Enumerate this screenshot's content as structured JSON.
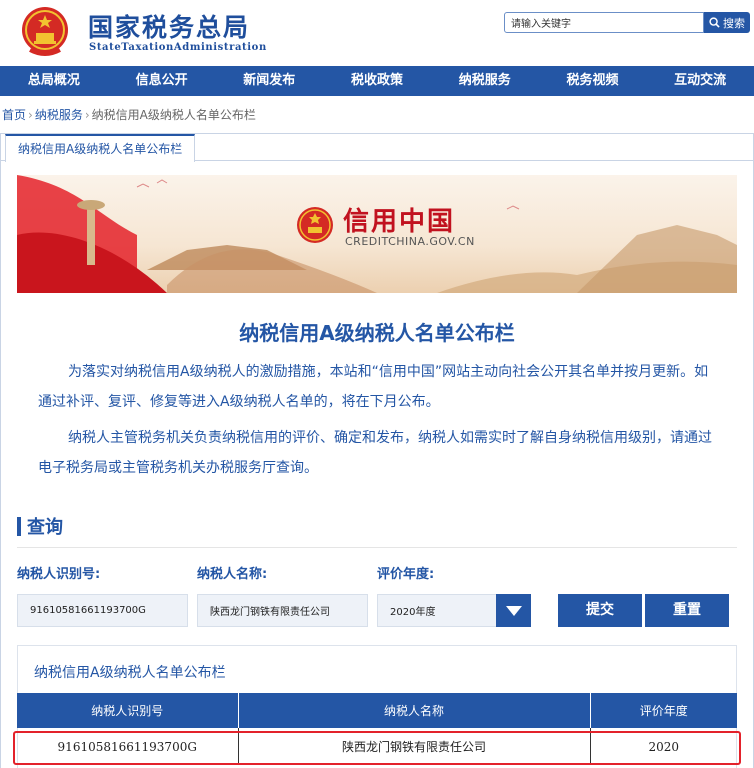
{
  "header": {
    "title": "国家税务总局",
    "subtitle": "StateTaxationAdministration",
    "search_value": "请输入关键字",
    "search_button": "搜索"
  },
  "nav": {
    "items": [
      "总局概况",
      "信息公开",
      "新闻发布",
      "税收政策",
      "纳税服务",
      "税务视频",
      "互动交流"
    ]
  },
  "breadcrumb": {
    "home": "首页",
    "level2": "纳税服务",
    "current": "纳税信用A级纳税人名单公布栏"
  },
  "tab": {
    "label": "纳税信用A级纳税人名单公布栏"
  },
  "banner": {
    "title": "信用中国",
    "url": "CREDITCHINA.GOV.CN"
  },
  "page": {
    "heading": "纳税信用A级纳税人名单公布栏",
    "intro1": "为落实对纳税信用A级纳税人的激励措施，本站和“信用中国”网站主动向社会公开其名单并按月更新。如通过补评、复评、修复等进入A级纳税人名单的，将在下月公布。",
    "intro2": "纳税人主管税务机关负责纳税信用的评价、确定和发布，纳税人如需实时了解自身纳税信用级别，请通过电子税务局或主管税务机关办税服务厅查询。"
  },
  "query": {
    "title": "查询",
    "id_label": "纳税人识别号:",
    "id_value": "91610581661193700G",
    "name_label": "纳税人名称:",
    "name_value": "陕西龙门钢铁有限责任公司",
    "year_label": "评价年度:",
    "year_value": "2020年度",
    "submit": "提交",
    "reset": "重置"
  },
  "results": {
    "title": "纳税信用A级纳税人名单公布栏",
    "headers": [
      "纳税人识别号",
      "纳税人名称",
      "评价年度"
    ],
    "rows": [
      [
        "91610581661193700G",
        "陕西龙门钢铁有限责任公司",
        "2020"
      ]
    ]
  },
  "colors": {
    "primary": "#2456a5",
    "highlight": "#e3222b",
    "banner_red": "#c1121f"
  }
}
